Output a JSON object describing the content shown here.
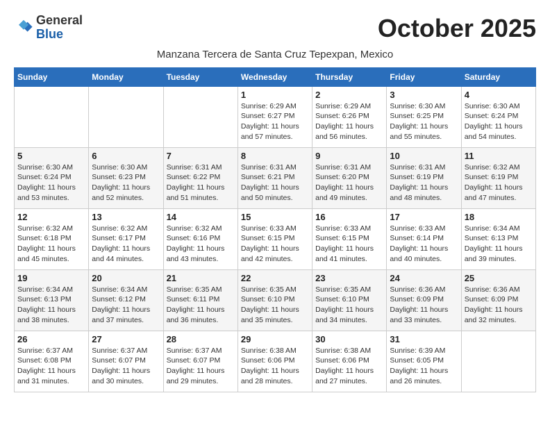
{
  "header": {
    "logo_line1": "General",
    "logo_line2": "Blue",
    "month_title": "October 2025",
    "subtitle": "Manzana Tercera de Santa Cruz Tepexpan, Mexico"
  },
  "weekdays": [
    "Sunday",
    "Monday",
    "Tuesday",
    "Wednesday",
    "Thursday",
    "Friday",
    "Saturday"
  ],
  "weeks": [
    [
      {
        "day": "",
        "info": ""
      },
      {
        "day": "",
        "info": ""
      },
      {
        "day": "",
        "info": ""
      },
      {
        "day": "1",
        "info": "Sunrise: 6:29 AM\nSunset: 6:27 PM\nDaylight: 11 hours and 57 minutes."
      },
      {
        "day": "2",
        "info": "Sunrise: 6:29 AM\nSunset: 6:26 PM\nDaylight: 11 hours and 56 minutes."
      },
      {
        "day": "3",
        "info": "Sunrise: 6:30 AM\nSunset: 6:25 PM\nDaylight: 11 hours and 55 minutes."
      },
      {
        "day": "4",
        "info": "Sunrise: 6:30 AM\nSunset: 6:24 PM\nDaylight: 11 hours and 54 minutes."
      }
    ],
    [
      {
        "day": "5",
        "info": "Sunrise: 6:30 AM\nSunset: 6:24 PM\nDaylight: 11 hours and 53 minutes."
      },
      {
        "day": "6",
        "info": "Sunrise: 6:30 AM\nSunset: 6:23 PM\nDaylight: 11 hours and 52 minutes."
      },
      {
        "day": "7",
        "info": "Sunrise: 6:31 AM\nSunset: 6:22 PM\nDaylight: 11 hours and 51 minutes."
      },
      {
        "day": "8",
        "info": "Sunrise: 6:31 AM\nSunset: 6:21 PM\nDaylight: 11 hours and 50 minutes."
      },
      {
        "day": "9",
        "info": "Sunrise: 6:31 AM\nSunset: 6:20 PM\nDaylight: 11 hours and 49 minutes."
      },
      {
        "day": "10",
        "info": "Sunrise: 6:31 AM\nSunset: 6:19 PM\nDaylight: 11 hours and 48 minutes."
      },
      {
        "day": "11",
        "info": "Sunrise: 6:32 AM\nSunset: 6:19 PM\nDaylight: 11 hours and 47 minutes."
      }
    ],
    [
      {
        "day": "12",
        "info": "Sunrise: 6:32 AM\nSunset: 6:18 PM\nDaylight: 11 hours and 45 minutes."
      },
      {
        "day": "13",
        "info": "Sunrise: 6:32 AM\nSunset: 6:17 PM\nDaylight: 11 hours and 44 minutes."
      },
      {
        "day": "14",
        "info": "Sunrise: 6:32 AM\nSunset: 6:16 PM\nDaylight: 11 hours and 43 minutes."
      },
      {
        "day": "15",
        "info": "Sunrise: 6:33 AM\nSunset: 6:15 PM\nDaylight: 11 hours and 42 minutes."
      },
      {
        "day": "16",
        "info": "Sunrise: 6:33 AM\nSunset: 6:15 PM\nDaylight: 11 hours and 41 minutes."
      },
      {
        "day": "17",
        "info": "Sunrise: 6:33 AM\nSunset: 6:14 PM\nDaylight: 11 hours and 40 minutes."
      },
      {
        "day": "18",
        "info": "Sunrise: 6:34 AM\nSunset: 6:13 PM\nDaylight: 11 hours and 39 minutes."
      }
    ],
    [
      {
        "day": "19",
        "info": "Sunrise: 6:34 AM\nSunset: 6:13 PM\nDaylight: 11 hours and 38 minutes."
      },
      {
        "day": "20",
        "info": "Sunrise: 6:34 AM\nSunset: 6:12 PM\nDaylight: 11 hours and 37 minutes."
      },
      {
        "day": "21",
        "info": "Sunrise: 6:35 AM\nSunset: 6:11 PM\nDaylight: 11 hours and 36 minutes."
      },
      {
        "day": "22",
        "info": "Sunrise: 6:35 AM\nSunset: 6:10 PM\nDaylight: 11 hours and 35 minutes."
      },
      {
        "day": "23",
        "info": "Sunrise: 6:35 AM\nSunset: 6:10 PM\nDaylight: 11 hours and 34 minutes."
      },
      {
        "day": "24",
        "info": "Sunrise: 6:36 AM\nSunset: 6:09 PM\nDaylight: 11 hours and 33 minutes."
      },
      {
        "day": "25",
        "info": "Sunrise: 6:36 AM\nSunset: 6:09 PM\nDaylight: 11 hours and 32 minutes."
      }
    ],
    [
      {
        "day": "26",
        "info": "Sunrise: 6:37 AM\nSunset: 6:08 PM\nDaylight: 11 hours and 31 minutes."
      },
      {
        "day": "27",
        "info": "Sunrise: 6:37 AM\nSunset: 6:07 PM\nDaylight: 11 hours and 30 minutes."
      },
      {
        "day": "28",
        "info": "Sunrise: 6:37 AM\nSunset: 6:07 PM\nDaylight: 11 hours and 29 minutes."
      },
      {
        "day": "29",
        "info": "Sunrise: 6:38 AM\nSunset: 6:06 PM\nDaylight: 11 hours and 28 minutes."
      },
      {
        "day": "30",
        "info": "Sunrise: 6:38 AM\nSunset: 6:06 PM\nDaylight: 11 hours and 27 minutes."
      },
      {
        "day": "31",
        "info": "Sunrise: 6:39 AM\nSunset: 6:05 PM\nDaylight: 11 hours and 26 minutes."
      },
      {
        "day": "",
        "info": ""
      }
    ]
  ]
}
